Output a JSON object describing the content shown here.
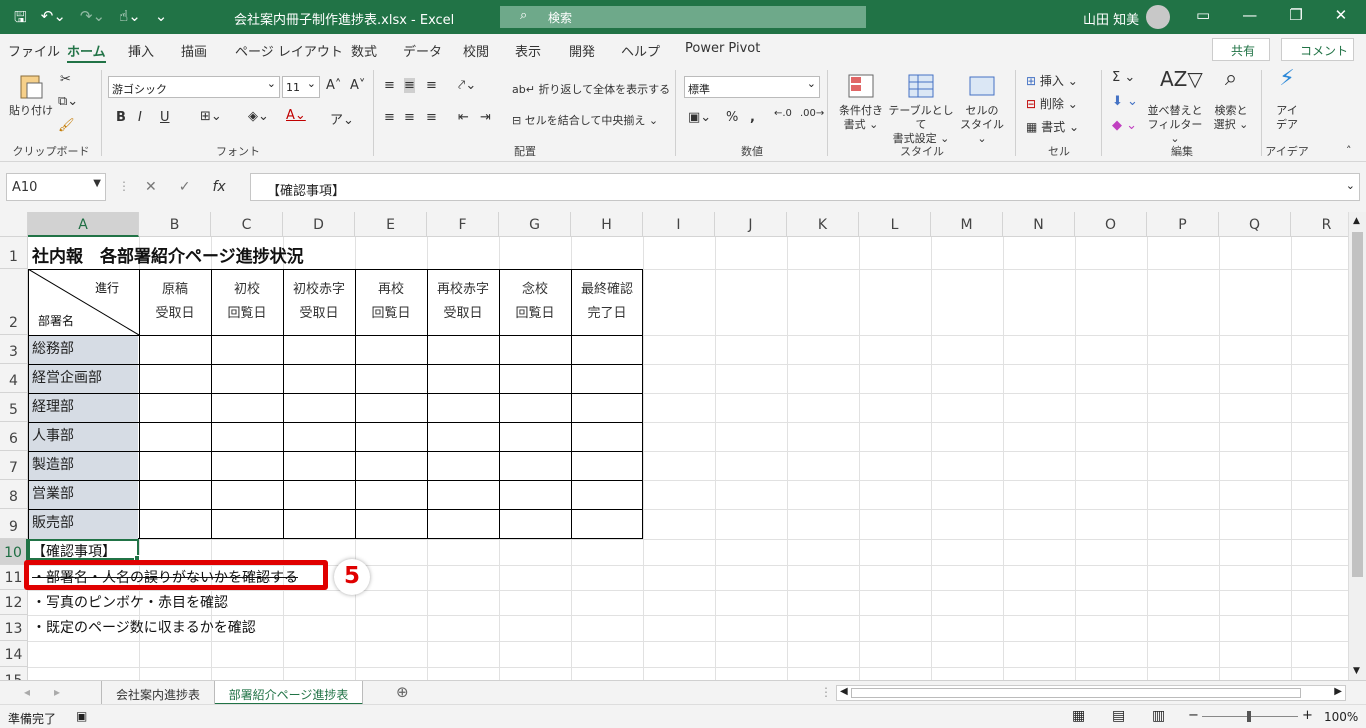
{
  "title_bar": {
    "title": "会社案内冊子制作進捗表.xlsx  -  Excel",
    "search_placeholder": "検索",
    "user_name": "山田 知美"
  },
  "ribbon_tabs": [
    "ファイル",
    "ホーム",
    "挿入",
    "描画",
    "ページ レイアウト",
    "数式",
    "データ",
    "校閲",
    "表示",
    "開発",
    "ヘルプ",
    "Power Pivot"
  ],
  "active_tab": "ホーム",
  "share_label": "共有",
  "comment_label": "コメント",
  "ribbon": {
    "clipboard": {
      "label": "クリップボード",
      "paste": "貼り付け"
    },
    "font": {
      "label": "フォント",
      "font_name": "游ゴシック",
      "font_size": "11",
      "bold": "B",
      "italic": "I",
      "underline": "U"
    },
    "alignment": {
      "label": "配置",
      "wrap_text": "折り返して全体を表示する",
      "merge_center": "セルを結合して中央揃え"
    },
    "number": {
      "label": "数値",
      "format": "標準"
    },
    "styles": {
      "label": "スタイル",
      "conditional": "条件付き",
      "conditional2": "書式",
      "table": "テーブルとして",
      "table2": "書式設定",
      "cell_styles": "セルの",
      "cell_styles2": "スタイル"
    },
    "cells": {
      "label": "セル",
      "insert": "挿入",
      "delete": "削除",
      "format": "書式"
    },
    "editing": {
      "label": "編集",
      "sort": "並べ替えと",
      "sort2": "フィルター",
      "find": "検索と",
      "find2": "選択"
    },
    "ideas": {
      "label": "アイデア",
      "ideas_btn": "アイ",
      "ideas_btn2": "デア"
    }
  },
  "name_box": "A10",
  "formula_bar": "【確認事項】",
  "columns": [
    "A",
    "B",
    "C",
    "D",
    "E",
    "F",
    "G",
    "H",
    "I",
    "J",
    "K",
    "L",
    "M",
    "N",
    "O",
    "P",
    "Q",
    "R"
  ],
  "rows": [
    "1",
    "2",
    "3",
    "4",
    "5",
    "6",
    "7",
    "8",
    "9",
    "10",
    "11",
    "12",
    "13",
    "14",
    "15"
  ],
  "sheet": {
    "title": "社内報　各部署紹介ページ進捗状況",
    "diag_top": "進行",
    "diag_bottom": "部署名",
    "headers": [
      {
        "l1": "原稿",
        "l2": "受取日"
      },
      {
        "l1": "初校",
        "l2": "回覧日"
      },
      {
        "l1": "初校赤字",
        "l2": "受取日"
      },
      {
        "l1": "再校",
        "l2": "回覧日"
      },
      {
        "l1": "再校赤字",
        "l2": "受取日"
      },
      {
        "l1": "念校",
        "l2": "回覧日"
      },
      {
        "l1": "最終確認",
        "l2": "完了日"
      }
    ],
    "departments": [
      "総務部",
      "経営企画部",
      "経理部",
      "人事部",
      "製造部",
      "営業部",
      "販売部"
    ],
    "notes_title": "【確認事項】",
    "notes": [
      "・部署名・人名の誤りがないかを確認する",
      "・写真のピンボケ・赤目を確認",
      "・既定のページ数に収まるかを確認"
    ],
    "callout_number": "5"
  },
  "sheet_tabs": [
    "会社案内進捗表",
    "部署紹介ページ進捗表"
  ],
  "active_sheet": "部署紹介ページ進捗表",
  "status": {
    "ready": "準備完了",
    "zoom": "100%"
  },
  "colors": {
    "excel_green": "#217346",
    "callout_red": "#e00000",
    "dept_fill": "#d6dce4"
  }
}
